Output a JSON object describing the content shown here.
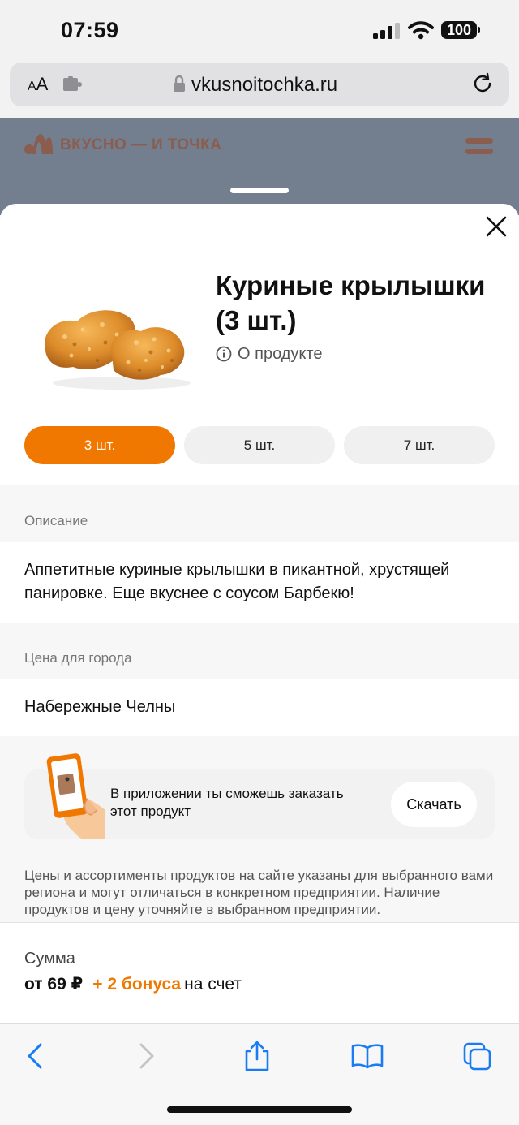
{
  "status_bar": {
    "time": "07:59",
    "battery": "100"
  },
  "browser": {
    "aa_label_small": "A",
    "aa_label_large": "A",
    "url": "vkusnoitochka.ru"
  },
  "site": {
    "logo_text": "ВКУСНО — И ТОЧКА"
  },
  "product": {
    "title": "Куриные крылышки (3 шт.)",
    "about_link": "О продукте",
    "portion_options": [
      {
        "label": "3 шт.",
        "selected": true
      },
      {
        "label": "5 шт.",
        "selected": false
      },
      {
        "label": "7 шт.",
        "selected": false
      }
    ],
    "description_label": "Описание",
    "description": "Аппетитные куриные крылышки в пикантной, хрустящей панировке. Еще вкуснее с соусом Барбекю!",
    "city_label": "Цена для города",
    "city": "Набережные Челны"
  },
  "promo": {
    "text": "В приложении ты сможешь заказать этот продукт",
    "button": "Скачать"
  },
  "disclaimer": "Цены и ассортименты продуктов на сайте указаны для выбранного вами региона и могут отличаться в конкретном предприятии. Наличие продуктов и цену уточняйте в выбранном предприятии.",
  "summary": {
    "label": "Сумма",
    "price": "от 69 ₽",
    "bonus": "+ 2 бонуса",
    "bonus_suffix": "на счет"
  },
  "colors": {
    "accent": "#f07800",
    "header_dim": "#737f8f",
    "ios_blue": "#1a7cf5"
  }
}
